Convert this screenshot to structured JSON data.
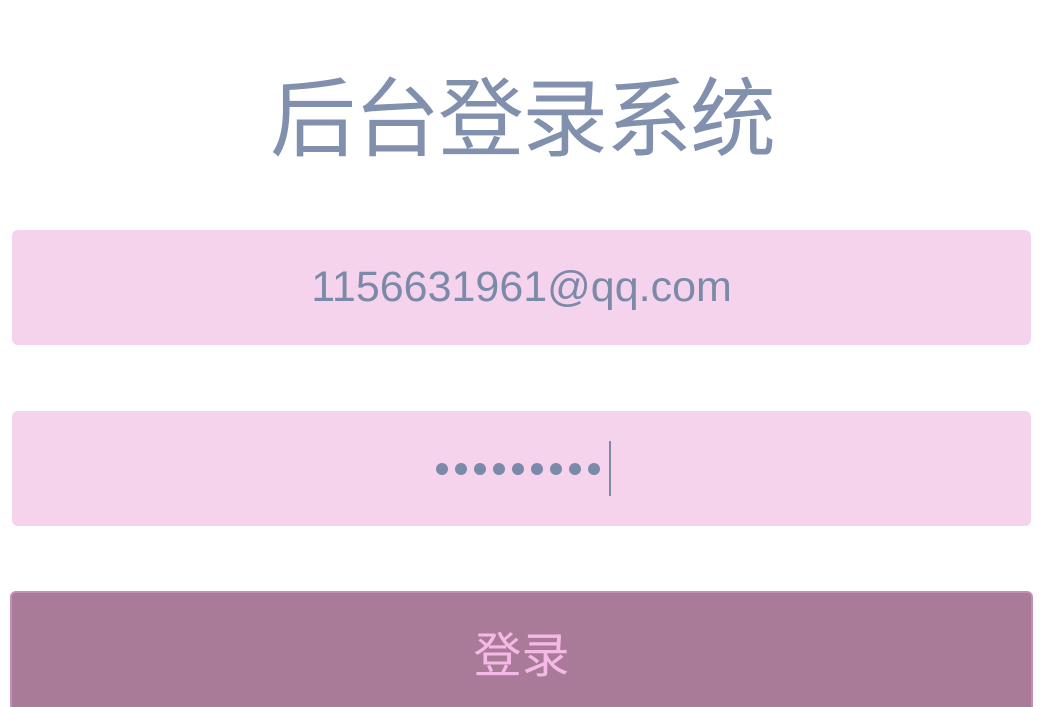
{
  "page": {
    "title": "后台登录系统"
  },
  "form": {
    "email_value": "1156631961@qq.com",
    "password_mask": "•••••••••",
    "login_label": "登录"
  },
  "colors": {
    "title": "#8090ad",
    "input_background": "#f6d3ec",
    "input_text": "#7b8aa9",
    "button_background": "#a97b98",
    "button_text": "#f4b9e6",
    "button_border": "#c58eb4"
  }
}
